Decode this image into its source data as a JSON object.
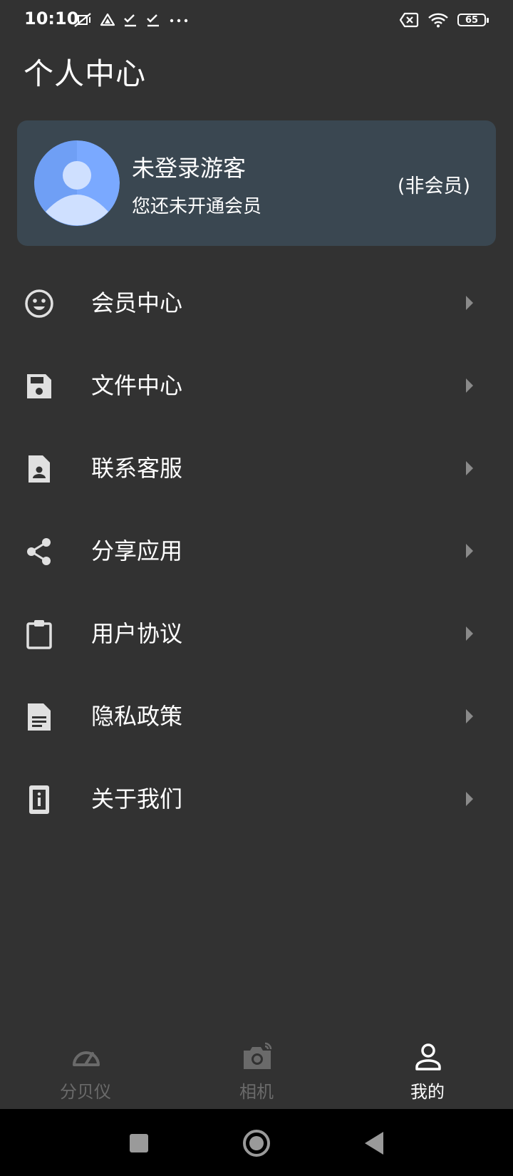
{
  "status_bar": {
    "time": "10:10",
    "left_icons": [
      "muted-vibrate-icon",
      "drive-icon",
      "check-icon",
      "check-icon",
      "more-dots-icon"
    ],
    "right_icons": [
      "sim-off-icon",
      "wifi-icon",
      "battery-icon"
    ],
    "battery_level": "65"
  },
  "header": {
    "title": "个人中心"
  },
  "profile": {
    "name": "未登录游客",
    "subtitle": "您还未开通会员",
    "membership": "(非会员)",
    "avatar_colors": {
      "bg": "#7aa9ff",
      "fg": "#cfe0ff"
    }
  },
  "menu": {
    "items": [
      {
        "label": "会员中心",
        "icon": "smiley-icon"
      },
      {
        "label": "文件中心",
        "icon": "save-icon"
      },
      {
        "label": "联系客服",
        "icon": "contact-card-icon"
      },
      {
        "label": "分享应用",
        "icon": "share-icon"
      },
      {
        "label": "用户协议",
        "icon": "clipboard-icon"
      },
      {
        "label": "隐私政策",
        "icon": "document-icon"
      },
      {
        "label": "关于我们",
        "icon": "info-icon"
      }
    ]
  },
  "bottom_nav": {
    "tabs": [
      {
        "label": "分贝仪",
        "icon": "gauge-icon",
        "active": false
      },
      {
        "label": "相机",
        "icon": "camera-icon",
        "active": false
      },
      {
        "label": "我的",
        "icon": "person-icon",
        "active": true
      }
    ]
  },
  "colors": {
    "background": "#323232",
    "card": "#3a4751",
    "icon": "#e0e0e0",
    "arrow": "#8a8a8a",
    "inactive_tab": "#6a6a6a",
    "system_nav": "#000000"
  }
}
